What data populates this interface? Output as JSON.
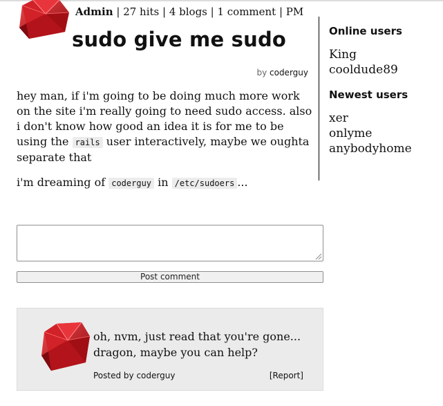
{
  "header": {
    "username": "Admin",
    "stats": " | 27 hits | 4 blogs | 1 comment | PM"
  },
  "post": {
    "title": "sudo give me sudo",
    "byline_prefix": "by",
    "author": "coderguy",
    "p1_before": "hey man, if i'm going to be doing much more work on the site i'm really going to need sudo access. also i don't know how good an idea it is for me to be using the ",
    "p1_code": "rails",
    "p1_after": " user interactively, maybe we oughta separate that",
    "p2_before": "i'm dreaming of ",
    "p2_code1": "coderguy",
    "p2_mid": " in ",
    "p2_code2": "/etc/sudoers",
    "p2_after": "..."
  },
  "sidebar": {
    "online_title": "Online users",
    "online_users": [
      "King",
      "cooldude89"
    ],
    "newest_title": "Newest users",
    "newest_users": [
      "xer",
      "onlyme",
      "anybodyhome"
    ]
  },
  "comment_form": {
    "textarea_value": "",
    "post_label": "Post comment"
  },
  "comments": [
    {
      "text": "oh, nvm, just read that you're gone... dragon, maybe you can help?",
      "posted_by": "Posted by coderguy",
      "report_label": "[Report]"
    }
  ],
  "colors": {
    "ruby": "#c8151c",
    "ruby_dark": "#7a0a0e",
    "card_bg": "#ebebeb"
  },
  "icons": {
    "site_logo": "ruby-gem-icon",
    "avatar": "ruby-gem-icon"
  }
}
